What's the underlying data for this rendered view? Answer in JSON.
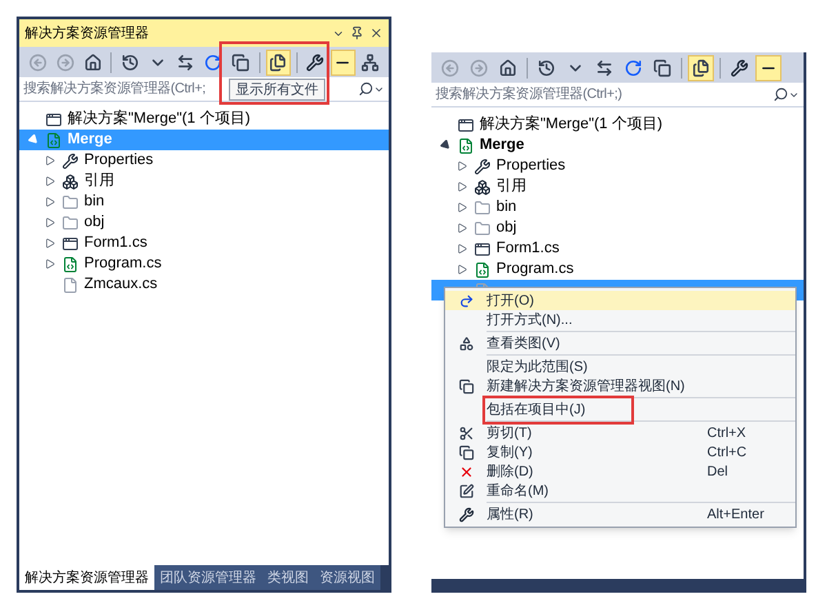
{
  "left_panel": {
    "title": "解决方案资源管理器",
    "toolbar": [
      {
        "kind": "back",
        "selected": false
      },
      {
        "kind": "forward",
        "selected": false
      },
      {
        "kind": "home",
        "selected": false
      },
      {
        "kind": "history",
        "selected": false
      },
      {
        "kind": "dropdown",
        "selected": false
      },
      {
        "kind": "sync",
        "selected": false
      },
      {
        "kind": "refresh",
        "selected": false
      },
      {
        "kind": "collapse",
        "selected": false
      },
      {
        "kind": "show_all",
        "selected": true
      },
      {
        "kind": "properties",
        "selected": false
      },
      {
        "kind": "preview",
        "selected": true
      },
      {
        "kind": "class_diagram",
        "selected": false
      }
    ],
    "tooltip": "显示所有文件",
    "search": {
      "placeholder": "搜索解决方案资源管理器(Ctrl+;"
    },
    "tree": [
      {
        "kind": "solution",
        "label": "解决方案\"Merge\"(1 个项目)",
        "selected": false,
        "children": [
          {
            "kind": "project",
            "label": "Merge",
            "selected": true,
            "expanded": true,
            "children": [
              {
                "kind": "properties",
                "label": "Properties",
                "selected": false,
                "expanded": false
              },
              {
                "kind": "references",
                "label": "引用",
                "selected": false,
                "expanded": false
              },
              {
                "kind": "hidden_folder",
                "label": "bin",
                "selected": false,
                "expanded": false
              },
              {
                "kind": "hidden_folder",
                "label": "obj",
                "selected": false,
                "expanded": false
              },
              {
                "kind": "form",
                "label": "Form1.cs",
                "selected": false,
                "expanded": false
              },
              {
                "kind": "csharp",
                "label": "Program.cs",
                "selected": false,
                "expanded": false
              },
              {
                "kind": "hidden_file",
                "label": "Zmcaux.cs",
                "selected": false
              }
            ]
          }
        ]
      }
    ],
    "tabs": [
      {
        "label": "解决方案资源管理器",
        "selected": true
      },
      {
        "label": "团队资源管理器",
        "selected": false
      },
      {
        "label": "类视图",
        "selected": false
      },
      {
        "label": "资源视图",
        "selected": false
      }
    ]
  },
  "right_panel": {
    "toolbar": [
      {
        "kind": "back",
        "selected": false
      },
      {
        "kind": "forward",
        "selected": false
      },
      {
        "kind": "home",
        "selected": false
      },
      {
        "kind": "history",
        "selected": false
      },
      {
        "kind": "dropdown",
        "selected": false
      },
      {
        "kind": "sync",
        "selected": false
      },
      {
        "kind": "refresh",
        "selected": false
      },
      {
        "kind": "collapse",
        "selected": false
      },
      {
        "kind": "show_all",
        "selected": true
      },
      {
        "kind": "properties",
        "selected": false
      },
      {
        "kind": "preview",
        "selected": true
      }
    ],
    "search": {
      "placeholder": "搜索解决方案资源管理器(Ctrl+;)"
    },
    "tree": [
      {
        "kind": "solution",
        "label": "解决方案\"Merge\"(1 个项目)",
        "selected": false,
        "children": [
          {
            "kind": "project",
            "label": "Merge",
            "selected": false,
            "expanded": true,
            "children": [
              {
                "kind": "properties",
                "label": "Properties",
                "selected": false,
                "expanded": false
              },
              {
                "kind": "references",
                "label": "引用",
                "selected": false,
                "expanded": false
              },
              {
                "kind": "hidden_folder",
                "label": "bin",
                "selected": false,
                "expanded": false
              },
              {
                "kind": "hidden_folder",
                "label": "obj",
                "selected": false,
                "expanded": false
              },
              {
                "kind": "form",
                "label": "Form1.cs",
                "selected": false,
                "expanded": false
              },
              {
                "kind": "csharp",
                "label": "Program.cs",
                "selected": false,
                "expanded": false
              },
              {
                "kind": "hidden_file",
                "selected": true
              }
            ]
          }
        ]
      }
    ],
    "context_menu": [
      {
        "kind": "open",
        "label": "打开(O)",
        "selected": true
      },
      {
        "kind": "plain",
        "label": "打开方式(N)...",
        "selected": false
      },
      {
        "kind": "separator"
      },
      {
        "kind": "class_view",
        "label": "查看类图(V)",
        "selected": false
      },
      {
        "kind": "separator"
      },
      {
        "kind": "plain",
        "label": "限定为此范围(S)",
        "selected": false
      },
      {
        "kind": "new_view",
        "label": "新建解决方案资源管理器视图(N)",
        "selected": false
      },
      {
        "kind": "separator"
      },
      {
        "kind": "plain",
        "label": "包括在项目中(J)",
        "selected": false,
        "annotated": true
      },
      {
        "kind": "separator"
      },
      {
        "kind": "cut",
        "label": "剪切(T)",
        "shortcut": "Ctrl+X",
        "selected": false
      },
      {
        "kind": "copy",
        "label": "复制(Y)",
        "shortcut": "Ctrl+C",
        "selected": false
      },
      {
        "kind": "delete",
        "label": "删除(D)",
        "shortcut": "Del",
        "selected": false
      },
      {
        "kind": "rename",
        "label": "重命名(M)",
        "selected": false
      },
      {
        "kind": "separator"
      },
      {
        "kind": "properties",
        "label": "属性(R)",
        "shortcut": "Alt+Enter",
        "selected": false
      }
    ]
  }
}
